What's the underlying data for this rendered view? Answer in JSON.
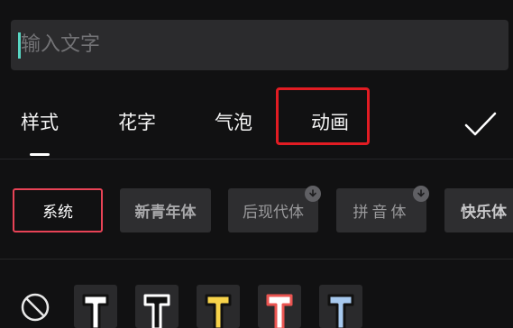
{
  "input": {
    "placeholder": "输入文字"
  },
  "tabs": [
    {
      "label": "样式",
      "active": true
    },
    {
      "label": "花字",
      "active": false
    },
    {
      "label": "气泡",
      "active": false
    },
    {
      "label": "动画",
      "active": false,
      "highlighted": true
    }
  ],
  "confirm_icon": "checkmark-icon",
  "fonts": [
    {
      "label": "系统",
      "selected": true
    },
    {
      "label": "新青年体",
      "selected": false
    },
    {
      "label": "后现代体",
      "selected": false,
      "download": true
    },
    {
      "label": "拼音体",
      "selected": false,
      "download": true
    },
    {
      "label": "快乐体",
      "selected": false
    }
  ],
  "styles": [
    {
      "name": "none",
      "icon": "no-style-icon"
    },
    {
      "name": "white-black-outline",
      "fill": "#ffffff",
      "stroke": "#111111"
    },
    {
      "name": "black-white-outline",
      "fill": "#111111",
      "stroke": "#ffffff"
    },
    {
      "name": "yellow-black-outline",
      "fill": "#f7d34a",
      "stroke": "#111111"
    },
    {
      "name": "white-red-outline",
      "fill": "#ffffff",
      "stroke": "#ea5451"
    },
    {
      "name": "blue-black-outline",
      "fill": "#a7c9ef",
      "stroke": "#111111"
    }
  ],
  "colors": {
    "highlight": "#e21c23",
    "selected_border": "#e84356",
    "caret": "#58d6c3"
  }
}
